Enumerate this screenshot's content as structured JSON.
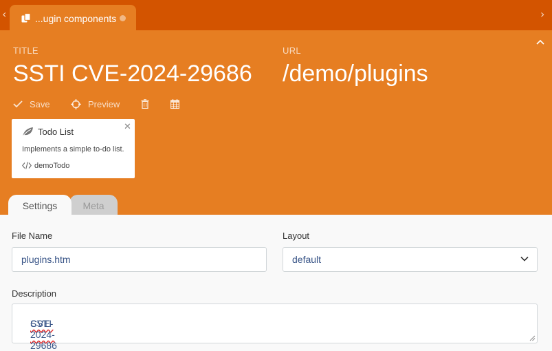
{
  "tab": {
    "label": "...ugin components"
  },
  "header": {
    "title_caption": "TITLE",
    "title_value": "SSTI CVE-2024-29686",
    "url_caption": "URL",
    "url_value": "/demo/plugins"
  },
  "toolbar": {
    "save_label": "Save",
    "preview_label": "Preview"
  },
  "plugin_card": {
    "title": "Todo List",
    "description": "Implements a simple to-do list.",
    "alias": "demoTodo"
  },
  "subtabs": [
    {
      "label": "Settings",
      "active": true
    },
    {
      "label": "Meta",
      "active": false
    }
  ],
  "form": {
    "file_name_label": "File Name",
    "file_name_value": "plugins.htm",
    "layout_label": "Layout",
    "layout_value": "default",
    "description_label": "Description",
    "description_words": [
      "SSTI",
      "CVE-2024-29686"
    ]
  },
  "colors": {
    "topbar": "#d35400",
    "accent": "#e67e22",
    "background": "#f9f9f9"
  }
}
